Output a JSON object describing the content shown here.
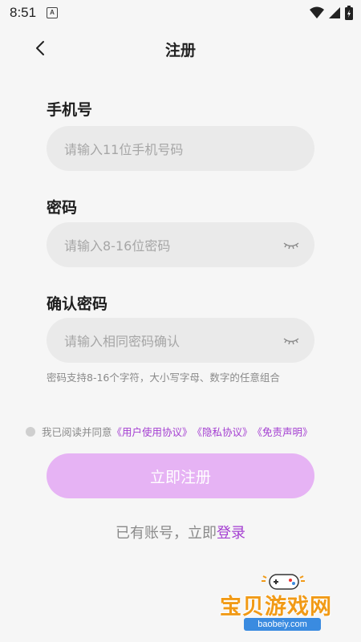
{
  "status_bar": {
    "time": "8:51",
    "notification": "A"
  },
  "header": {
    "title": "注册"
  },
  "phone": {
    "label": "手机号",
    "placeholder": "请输入11位手机号码"
  },
  "password": {
    "label": "密码",
    "placeholder": "请输入8-16位密码"
  },
  "confirm": {
    "label": "确认密码",
    "placeholder": "请输入相同密码确认"
  },
  "hint": "密码支持8-16个字符，大小写字母、数字的任意组合",
  "agreement": {
    "prefix": "我已阅读并同意",
    "user_agreement": "《用户使用协议》",
    "privacy": "《隐私协议》",
    "disclaimer": "《免责声明》"
  },
  "register_button": "立即注册",
  "login": {
    "prompt": "已有账号，立即",
    "link": "登录"
  },
  "watermark": {
    "title": "宝贝游戏网",
    "url": "baobeiy.com"
  },
  "colors": {
    "accent": "#a43ed1",
    "button": "#e6b3f4",
    "field_bg": "#eaeaea"
  }
}
